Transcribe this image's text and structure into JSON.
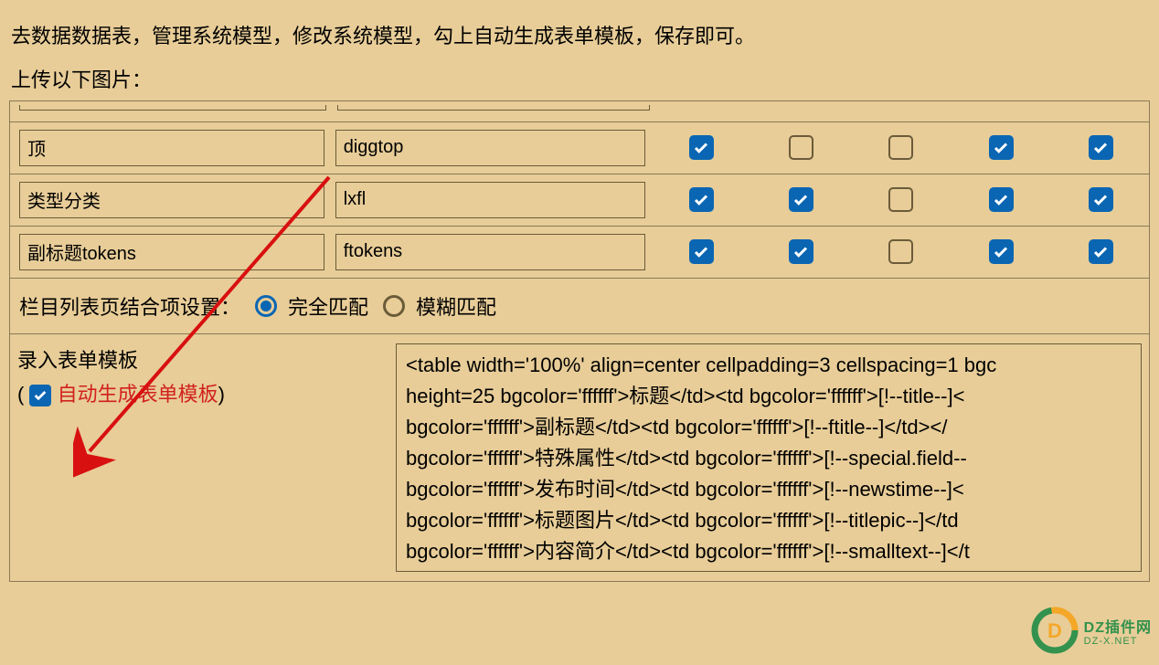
{
  "instruction": "去数据数据表，管理系统模型，修改系统模型，勾上自动生成表单模板，保存即可。",
  "upload_label": "上传以下图片：",
  "rows": [
    {
      "name": "顶",
      "field": "diggtop",
      "checks": [
        true,
        false,
        false,
        true,
        true
      ]
    },
    {
      "name": "类型分类",
      "field": "lxfl",
      "checks": [
        true,
        true,
        false,
        true,
        true
      ]
    },
    {
      "name": "副标题tokens",
      "field": "ftokens",
      "checks": [
        true,
        true,
        false,
        true,
        true
      ]
    }
  ],
  "match_setting": {
    "label": "栏目列表页结合项设置：",
    "option_exact": "完全匹配",
    "option_fuzzy": "模糊匹配",
    "selected": "exact"
  },
  "template": {
    "title": "录入表单模板",
    "paren_open": "( ",
    "auto_label": "自动生成表单模板",
    "paren_close": ")",
    "content": "<table width='100%' align=center cellpadding=3 cellspacing=1 bgc\nheight=25 bgcolor='ffffff'>标题</td><td bgcolor='ffffff'>[!--title--]<\nbgcolor='ffffff'>副标题</td><td bgcolor='ffffff'>[!--ftitle--]</td></\nbgcolor='ffffff'>特殊属性</td><td bgcolor='ffffff'>[!--special.field--\nbgcolor='ffffff'>发布时间</td><td bgcolor='ffffff'>[!--newstime--]<\nbgcolor='ffffff'>标题图片</td><td bgcolor='ffffff'>[!--titlepic--]</td\nbgcolor='ffffff'>内容简介</td><td bgcolor='ffffff'>[!--smalltext--]</t"
  },
  "watermark": {
    "brand": "DZ插件网",
    "sub": "DZ-X.NET"
  }
}
